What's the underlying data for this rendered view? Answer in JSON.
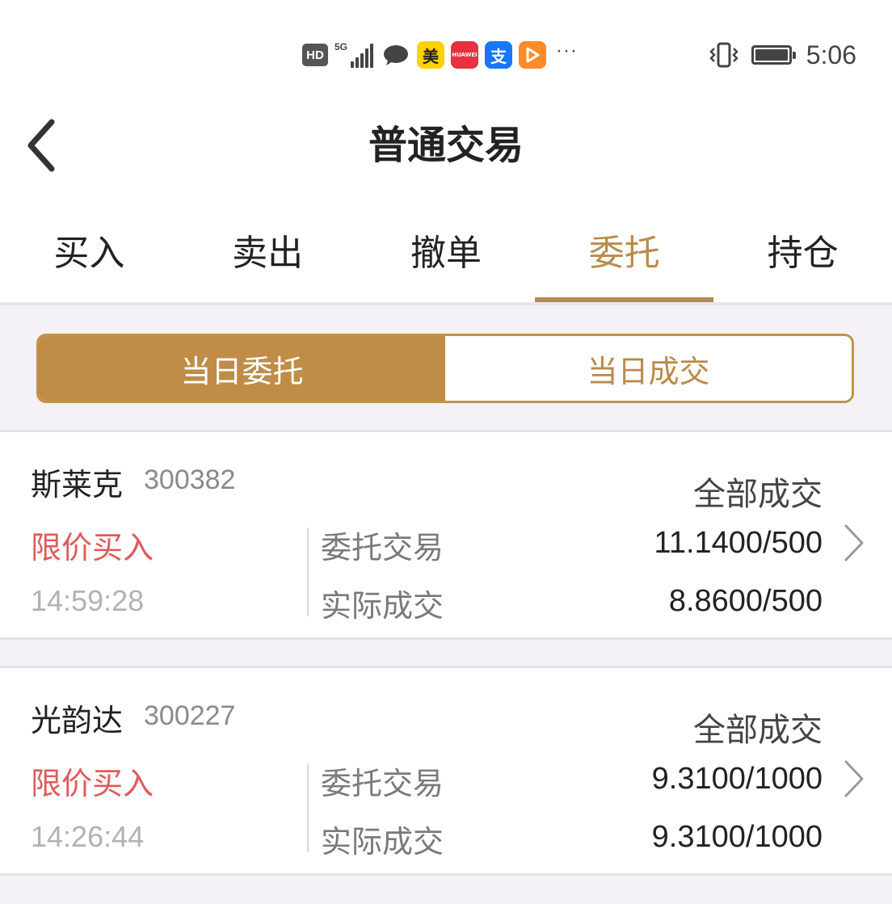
{
  "status_bar": {
    "hd": "HD",
    "network": "5G",
    "app_mei": "美",
    "app_huawei": "HUAWEI",
    "app_alipay": "支",
    "more": "···",
    "time": "5:06"
  },
  "header": {
    "title": "普通交易"
  },
  "tabs": [
    {
      "label": "买入"
    },
    {
      "label": "卖出"
    },
    {
      "label": "撤单"
    },
    {
      "label": "委托"
    },
    {
      "label": "持仓"
    }
  ],
  "segment": {
    "today_orders": "当日委托",
    "today_trades": "当日成交"
  },
  "orders": [
    {
      "name": "斯莱克",
      "code": "300382",
      "status": "全部成交",
      "type": "限价买入",
      "time": "14:59:28",
      "order_label": "委托交易",
      "order_value": "11.1400/500",
      "deal_label": "实际成交",
      "deal_value": "8.8600/500"
    },
    {
      "name": "光韵达",
      "code": "300227",
      "status": "全部成交",
      "type": "限价买入",
      "time": "14:26:44",
      "order_label": "委托交易",
      "order_value": "9.3100/1000",
      "deal_label": "实际成交",
      "deal_value": "9.3100/1000"
    }
  ],
  "colors": {
    "accent": "#bf8d48",
    "buy_red": "#e05a5a",
    "background_gray": "#f4f2f6"
  }
}
